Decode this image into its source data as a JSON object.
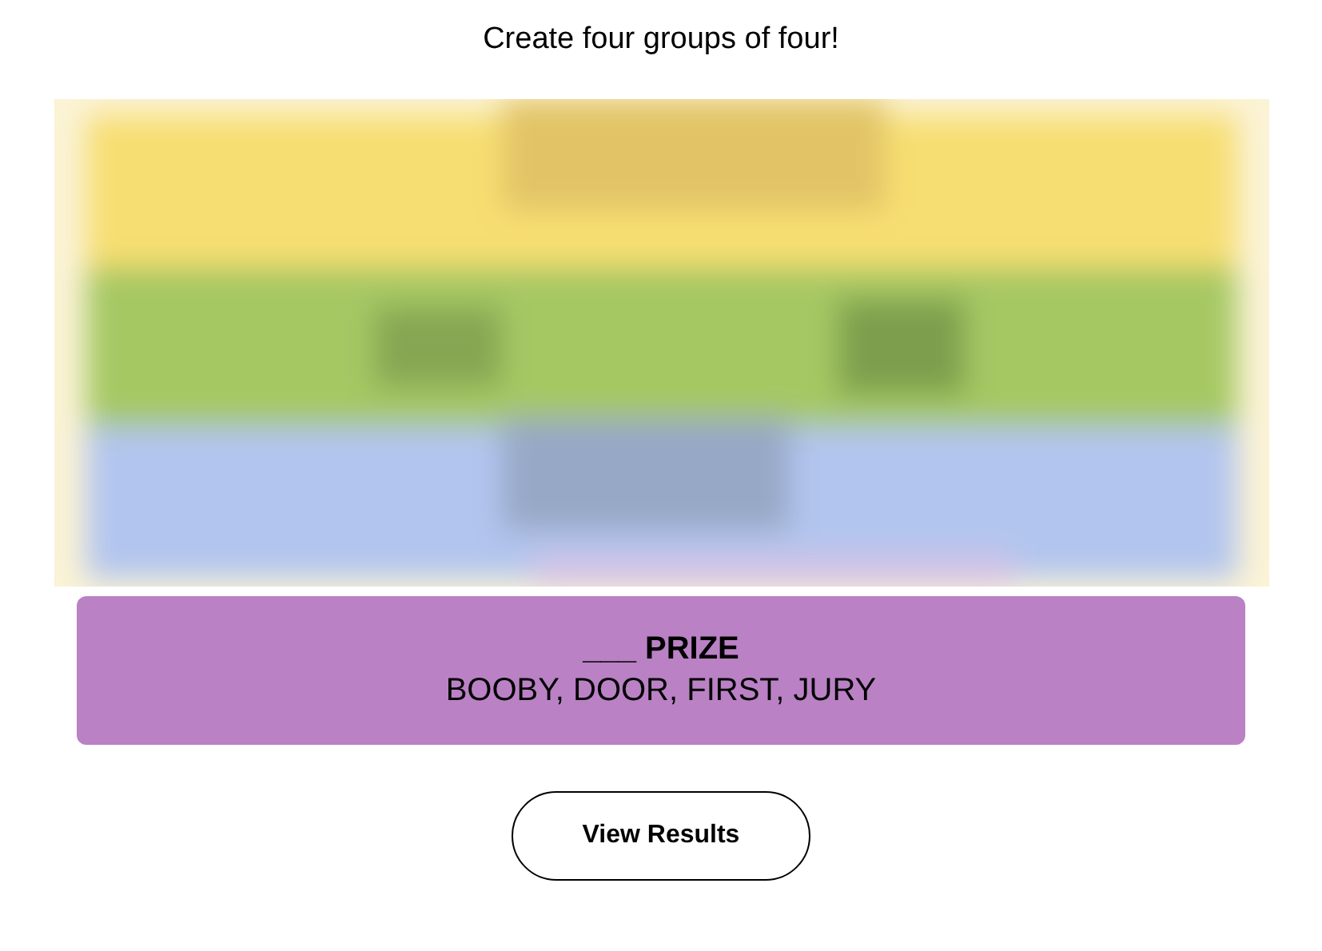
{
  "instruction": "Create four groups of four!",
  "solved_groups": [
    {
      "title": "___ PRIZE",
      "members": "BOOBY, DOOR, FIRST, JURY",
      "color": "#ba81c5"
    }
  ],
  "buttons": [
    {
      "label": "View Results"
    }
  ]
}
